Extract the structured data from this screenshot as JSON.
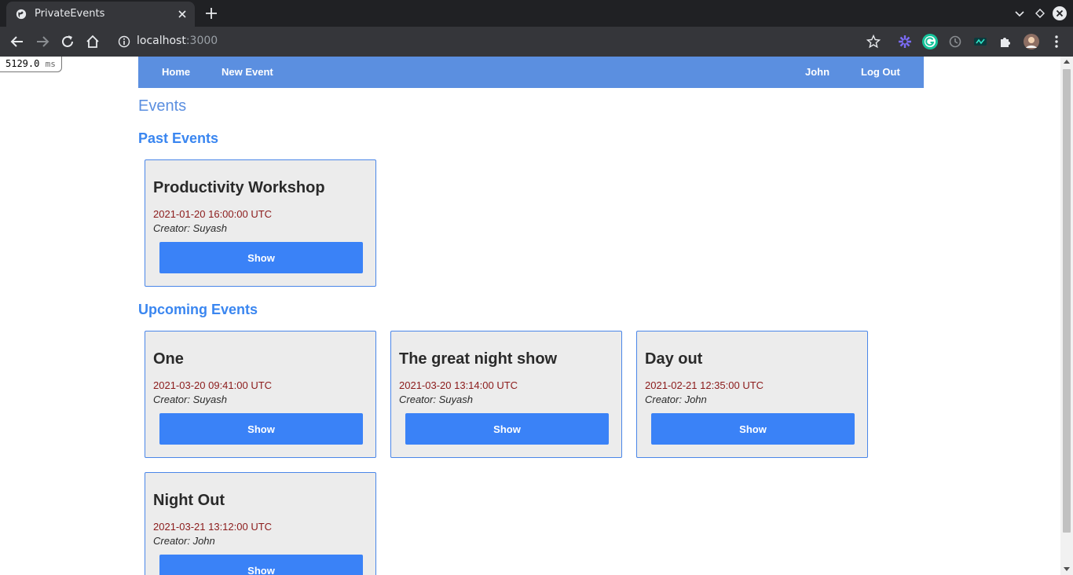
{
  "browser": {
    "tab_title": "PrivateEvents",
    "url_host": "localhost",
    "url_port": ":3000"
  },
  "timer": {
    "value": "5129.0",
    "unit": "ms"
  },
  "nav": {
    "home": "Home",
    "new_event": "New Event",
    "user": "John",
    "logout": "Log Out"
  },
  "page_title": "Events",
  "past": {
    "title": "Past Events",
    "events": [
      {
        "name": "Productivity Workshop",
        "date": "2021-01-20 16:00:00 UTC",
        "creator": "Creator: Suyash",
        "button": "Show"
      }
    ]
  },
  "upcoming": {
    "title": "Upcoming Events",
    "events": [
      {
        "name": "One",
        "date": "2021-03-20 09:41:00 UTC",
        "creator": "Creator: Suyash",
        "button": "Show"
      },
      {
        "name": "The great night show",
        "date": "2021-03-20 13:14:00 UTC",
        "creator": "Creator: Suyash",
        "button": "Show"
      },
      {
        "name": "Day out",
        "date": "2021-02-21 12:35:00 UTC",
        "creator": "Creator: John",
        "button": "Show"
      },
      {
        "name": "Night Out",
        "date": "2021-03-21 13:12:00 UTC",
        "creator": "Creator: John",
        "button": "Show"
      }
    ]
  },
  "colors": {
    "navbar": "#5b8fe0",
    "accent": "#3a86f0",
    "button": "#3a82f7",
    "date": "#8b1a1a"
  }
}
